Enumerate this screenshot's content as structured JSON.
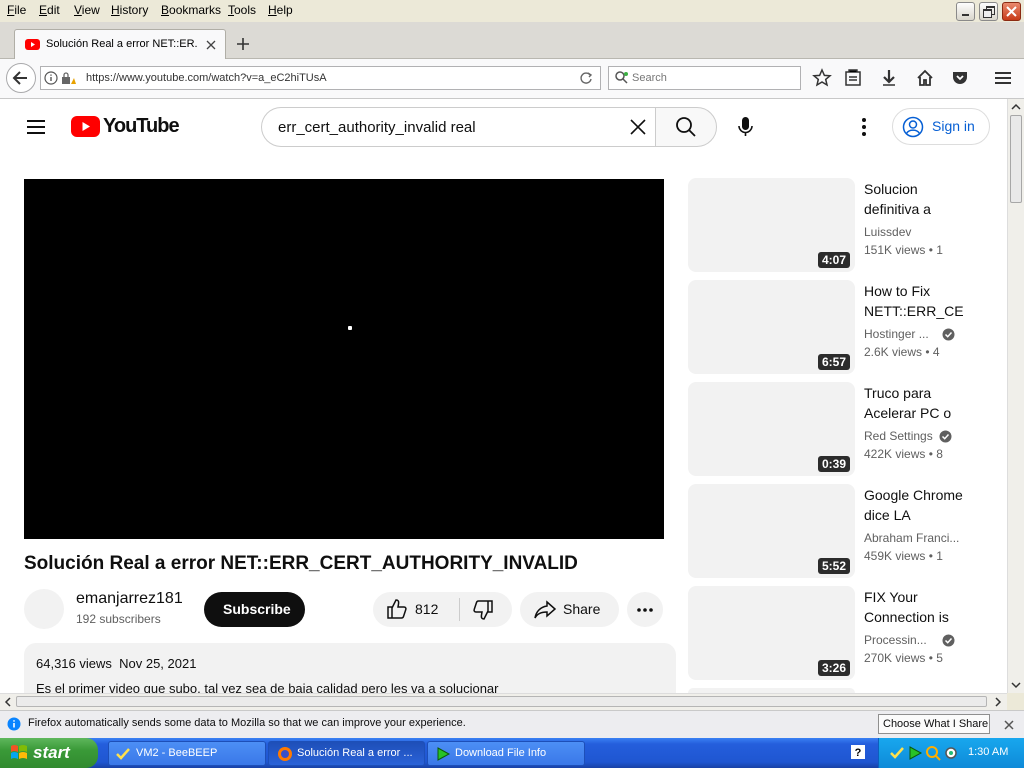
{
  "menubar": {
    "items": [
      "File",
      "Edit",
      "View",
      "History",
      "Bookmarks",
      "Tools",
      "Help"
    ]
  },
  "tab": {
    "title": "Solución Real a error NET::ER..."
  },
  "nav": {
    "url": "https://www.youtube.com/watch?v=a_eC2hiTUsA",
    "search_placeholder": "Search"
  },
  "youtube": {
    "brand": "YouTube",
    "search_query": "err_cert_authority_invalid real",
    "sign_in": "Sign in",
    "video_title": "Solución Real a error NET::ERR_CERT_AUTHORITY_INVALID",
    "channel": "emanjarrez181",
    "subscribers": "192 subscribers",
    "subscribe": "Subscribe",
    "likes": "812",
    "share": "Share",
    "views_date": "64,316 views  Nov 25, 2021",
    "description": "Es el primer video que subo, tal vez sea de baja calidad pero les va a solucionar",
    "related": [
      {
        "line1": "Solucion",
        "line2": "definitiva a",
        "channel": "Luissdev",
        "verified": false,
        "meta": "151K views  • 1",
        "duration": "4:07"
      },
      {
        "line1": "How to Fix",
        "line2": "NETT::ERR_CE",
        "channel": "Hostinger ...",
        "verified": true,
        "meta": "2.6K views  • 4",
        "duration": "6:57"
      },
      {
        "line1": "Truco para",
        "line2": "Acelerar PC o",
        "channel": "Red Settings",
        "verified": true,
        "meta": "422K views  • 8",
        "duration": "0:39"
      },
      {
        "line1": "Google Chrome",
        "line2": "dice LA",
        "channel": "Abraham Franci...",
        "verified": false,
        "meta": "459K views  • 1",
        "duration": "5:52"
      },
      {
        "line1": "FIX Your",
        "line2": "Connection is",
        "channel": "Processin...",
        "verified": true,
        "meta": "270K views  • 5",
        "duration": "3:26"
      }
    ]
  },
  "notification": {
    "text": "Firefox automatically sends some data to Mozilla so that we can improve your experience.",
    "button": "Choose What I Share"
  },
  "taskbar": {
    "start": "start",
    "items": [
      "VM2 - BeeBEEP",
      "Solución Real a error ...",
      "Download File Info"
    ],
    "clock": "1:30 AM"
  },
  "colors": {
    "youtube_red": "#ff0000",
    "signin_blue": "#065fd4",
    "xp_taskbar": "#245edc",
    "xp_start": "#3a9a38"
  }
}
